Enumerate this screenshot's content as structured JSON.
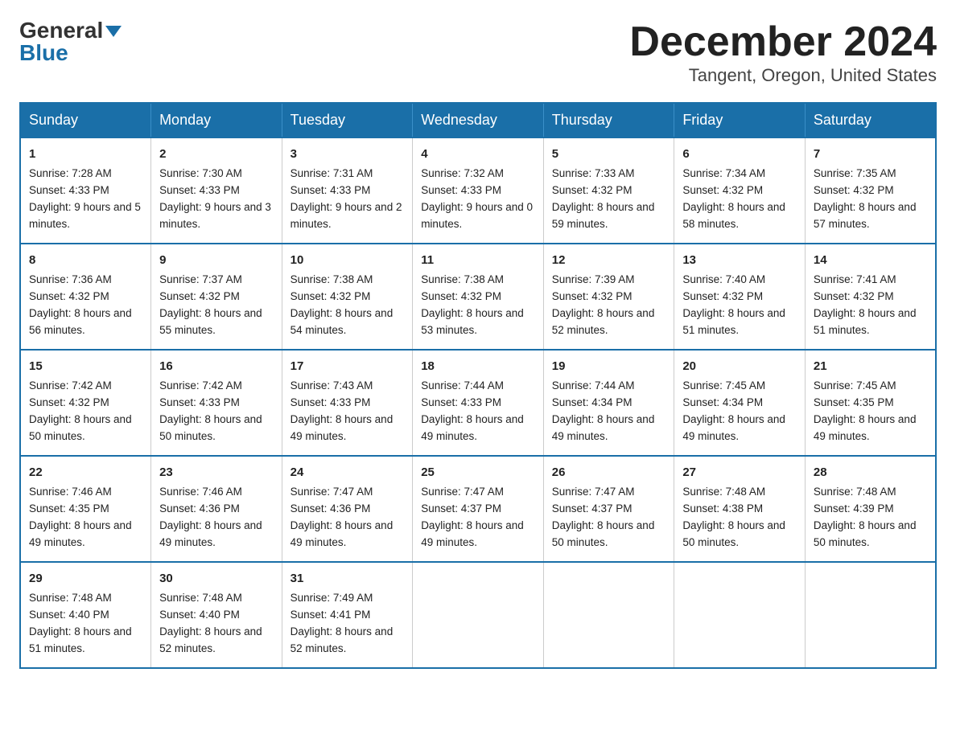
{
  "header": {
    "logo_general": "General",
    "logo_blue": "Blue",
    "month_title": "December 2024",
    "location": "Tangent, Oregon, United States"
  },
  "days_of_week": [
    "Sunday",
    "Monday",
    "Tuesday",
    "Wednesday",
    "Thursday",
    "Friday",
    "Saturday"
  ],
  "weeks": [
    [
      {
        "day": "1",
        "sunrise": "7:28 AM",
        "sunset": "4:33 PM",
        "daylight": "9 hours and 5 minutes."
      },
      {
        "day": "2",
        "sunrise": "7:30 AM",
        "sunset": "4:33 PM",
        "daylight": "9 hours and 3 minutes."
      },
      {
        "day": "3",
        "sunrise": "7:31 AM",
        "sunset": "4:33 PM",
        "daylight": "9 hours and 2 minutes."
      },
      {
        "day": "4",
        "sunrise": "7:32 AM",
        "sunset": "4:33 PM",
        "daylight": "9 hours and 0 minutes."
      },
      {
        "day": "5",
        "sunrise": "7:33 AM",
        "sunset": "4:32 PM",
        "daylight": "8 hours and 59 minutes."
      },
      {
        "day": "6",
        "sunrise": "7:34 AM",
        "sunset": "4:32 PM",
        "daylight": "8 hours and 58 minutes."
      },
      {
        "day": "7",
        "sunrise": "7:35 AM",
        "sunset": "4:32 PM",
        "daylight": "8 hours and 57 minutes."
      }
    ],
    [
      {
        "day": "8",
        "sunrise": "7:36 AM",
        "sunset": "4:32 PM",
        "daylight": "8 hours and 56 minutes."
      },
      {
        "day": "9",
        "sunrise": "7:37 AM",
        "sunset": "4:32 PM",
        "daylight": "8 hours and 55 minutes."
      },
      {
        "day": "10",
        "sunrise": "7:38 AM",
        "sunset": "4:32 PM",
        "daylight": "8 hours and 54 minutes."
      },
      {
        "day": "11",
        "sunrise": "7:38 AM",
        "sunset": "4:32 PM",
        "daylight": "8 hours and 53 minutes."
      },
      {
        "day": "12",
        "sunrise": "7:39 AM",
        "sunset": "4:32 PM",
        "daylight": "8 hours and 52 minutes."
      },
      {
        "day": "13",
        "sunrise": "7:40 AM",
        "sunset": "4:32 PM",
        "daylight": "8 hours and 51 minutes."
      },
      {
        "day": "14",
        "sunrise": "7:41 AM",
        "sunset": "4:32 PM",
        "daylight": "8 hours and 51 minutes."
      }
    ],
    [
      {
        "day": "15",
        "sunrise": "7:42 AM",
        "sunset": "4:32 PM",
        "daylight": "8 hours and 50 minutes."
      },
      {
        "day": "16",
        "sunrise": "7:42 AM",
        "sunset": "4:33 PM",
        "daylight": "8 hours and 50 minutes."
      },
      {
        "day": "17",
        "sunrise": "7:43 AM",
        "sunset": "4:33 PM",
        "daylight": "8 hours and 49 minutes."
      },
      {
        "day": "18",
        "sunrise": "7:44 AM",
        "sunset": "4:33 PM",
        "daylight": "8 hours and 49 minutes."
      },
      {
        "day": "19",
        "sunrise": "7:44 AM",
        "sunset": "4:34 PM",
        "daylight": "8 hours and 49 minutes."
      },
      {
        "day": "20",
        "sunrise": "7:45 AM",
        "sunset": "4:34 PM",
        "daylight": "8 hours and 49 minutes."
      },
      {
        "day": "21",
        "sunrise": "7:45 AM",
        "sunset": "4:35 PM",
        "daylight": "8 hours and 49 minutes."
      }
    ],
    [
      {
        "day": "22",
        "sunrise": "7:46 AM",
        "sunset": "4:35 PM",
        "daylight": "8 hours and 49 minutes."
      },
      {
        "day": "23",
        "sunrise": "7:46 AM",
        "sunset": "4:36 PM",
        "daylight": "8 hours and 49 minutes."
      },
      {
        "day": "24",
        "sunrise": "7:47 AM",
        "sunset": "4:36 PM",
        "daylight": "8 hours and 49 minutes."
      },
      {
        "day": "25",
        "sunrise": "7:47 AM",
        "sunset": "4:37 PM",
        "daylight": "8 hours and 49 minutes."
      },
      {
        "day": "26",
        "sunrise": "7:47 AM",
        "sunset": "4:37 PM",
        "daylight": "8 hours and 50 minutes."
      },
      {
        "day": "27",
        "sunrise": "7:48 AM",
        "sunset": "4:38 PM",
        "daylight": "8 hours and 50 minutes."
      },
      {
        "day": "28",
        "sunrise": "7:48 AM",
        "sunset": "4:39 PM",
        "daylight": "8 hours and 50 minutes."
      }
    ],
    [
      {
        "day": "29",
        "sunrise": "7:48 AM",
        "sunset": "4:40 PM",
        "daylight": "8 hours and 51 minutes."
      },
      {
        "day": "30",
        "sunrise": "7:48 AM",
        "sunset": "4:40 PM",
        "daylight": "8 hours and 52 minutes."
      },
      {
        "day": "31",
        "sunrise": "7:49 AM",
        "sunset": "4:41 PM",
        "daylight": "8 hours and 52 minutes."
      },
      null,
      null,
      null,
      null
    ]
  ]
}
